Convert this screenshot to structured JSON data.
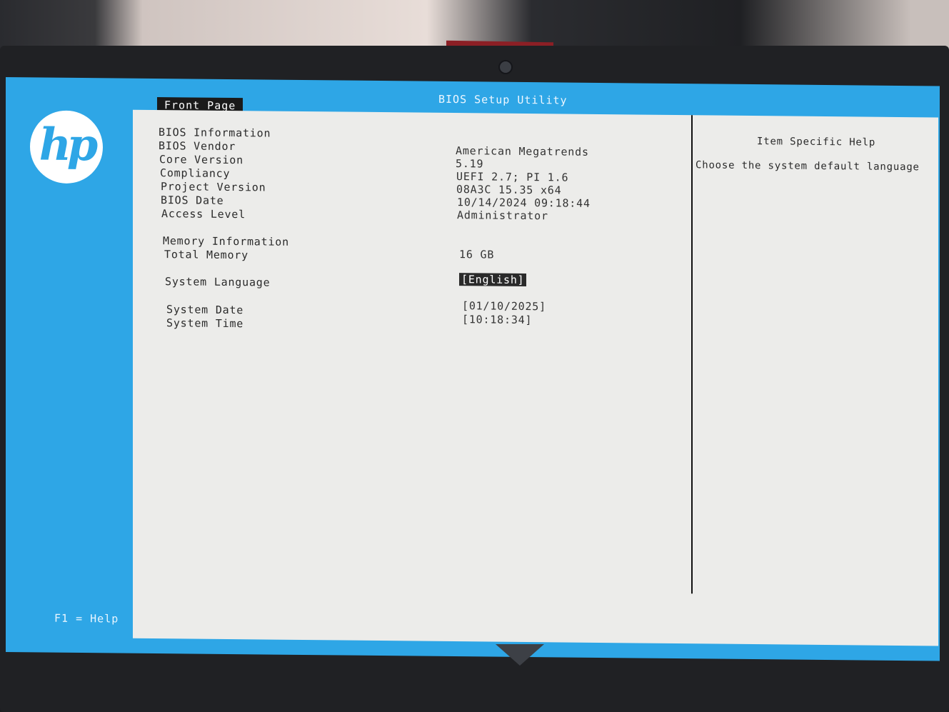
{
  "title": "BIOS Setup Utility",
  "tab": "Front Page",
  "logo_text": "hp",
  "rows": [
    {
      "label": "BIOS Information",
      "value": ""
    },
    {
      "label": "BIOS Vendor",
      "value": "American Megatrends"
    },
    {
      "label": "Core Version",
      "value": "5.19"
    },
    {
      "label": "Compliancy",
      "value": "UEFI 2.7; PI 1.6"
    },
    {
      "label": "Project Version",
      "value": "08A3C 15.35 x64"
    },
    {
      "label": "BIOS Date",
      "value": "10/14/2024 09:18:44"
    },
    {
      "label": "Access Level",
      "value": "Administrator"
    },
    {
      "label": "Memory Information",
      "value": ""
    },
    {
      "label": "Total Memory",
      "value": "16 GB"
    },
    {
      "label": "System Language",
      "value": "[English]"
    },
    {
      "label": "System Date",
      "value": "[01/10/2025]"
    },
    {
      "label": "System Time",
      "value": "[10:18:34]"
    }
  ],
  "help": {
    "title": "Item Specific Help",
    "text": "Choose the system default language"
  },
  "footer": {
    "f1": "F1 = Help"
  },
  "colors": {
    "accent": "#2ea6e6",
    "panel": "#ececea",
    "text": "#2a2a2a"
  }
}
